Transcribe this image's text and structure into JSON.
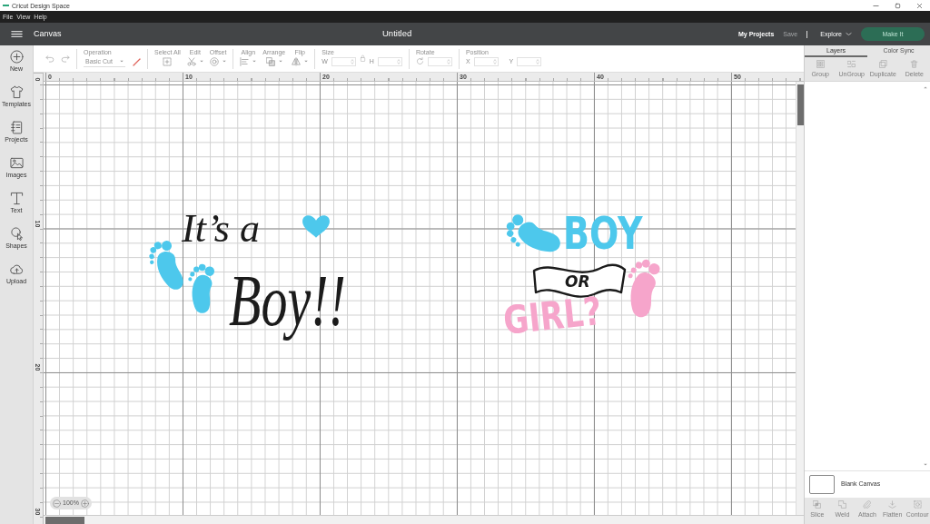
{
  "window": {
    "title": "Cricut Design Space"
  },
  "menu": [
    {
      "label": "File"
    },
    {
      "label": "View"
    },
    {
      "label": "Help"
    }
  ],
  "header": {
    "section": "Canvas",
    "document_title": "Untitled",
    "links": [
      {
        "label": "My Projects",
        "disabled": false
      },
      {
        "label": "Save",
        "disabled": true
      }
    ],
    "explore": {
      "label": "Explore"
    },
    "make_it": {
      "label": "Make It",
      "disabled": true
    }
  },
  "sidebar": {
    "items": [
      {
        "label": "New"
      },
      {
        "label": "Templates"
      },
      {
        "label": "Projects"
      },
      {
        "label": "Images"
      },
      {
        "label": "Text"
      },
      {
        "label": "Shapes"
      },
      {
        "label": "Upload"
      }
    ]
  },
  "toolbar": {
    "groups": [
      {
        "items": [
          {
            "kind": "undo",
            "disabled": true
          },
          {
            "kind": "redo",
            "disabled": true
          }
        ]
      },
      {
        "items": [
          {
            "kind": "dropdown",
            "label": "Operation",
            "value": "Basic Cut",
            "disabled": true
          }
        ]
      },
      {
        "items": [
          {
            "kind": "select_all",
            "label": "Select All",
            "menu": false,
            "disabled": true
          },
          {
            "kind": "edit",
            "label": "Edit",
            "menu": true,
            "disabled": true
          },
          {
            "kind": "offset",
            "label": "Offset",
            "menu": true,
            "disabled": true
          }
        ]
      },
      {
        "items": [
          {
            "kind": "align",
            "label": "Align",
            "menu": true,
            "disabled": true
          },
          {
            "kind": "arrange",
            "label": "Arrange",
            "menu": true,
            "disabled": true
          },
          {
            "kind": "flip",
            "label": "Flip",
            "menu": true,
            "disabled": true
          }
        ]
      },
      {
        "items": [
          {
            "kind": "size",
            "label": "Size",
            "fields": [
              {
                "label": "W"
              },
              {
                "label": "H"
              }
            ],
            "disabled": true
          }
        ]
      },
      {
        "items": [
          {
            "kind": "rotate",
            "label": "Rotate",
            "disabled": true
          }
        ]
      },
      {
        "items": [
          {
            "kind": "position",
            "label": "Position",
            "fields": [
              {
                "label": "X"
              },
              {
                "label": "Y"
              }
            ],
            "disabled": true
          }
        ]
      }
    ]
  },
  "rulers": {
    "horizontal": [
      "0",
      "10",
      "20",
      "30",
      "40",
      "50"
    ],
    "vertical": [
      "0",
      "10",
      "20",
      "30"
    ]
  },
  "canvas": {
    "designs": [
      {
        "kind": "its_a_boy",
        "texts": [
          {
            "text": "It’s a",
            "color": "#1b1b1b"
          },
          {
            "text": "Boy!!",
            "color": "#1b1b1b"
          }
        ],
        "footprints": [
          {
            "color": "#4dc8ec"
          },
          {
            "color": "#4dc8ec"
          }
        ],
        "heart": {
          "color": "#4dc8ec"
        }
      },
      {
        "kind": "boy_or_girl",
        "texts": [
          {
            "text": "BOY",
            "color": "#4dc8ec"
          },
          {
            "text": "OR",
            "color": "#1b1b1b"
          },
          {
            "text": "GIRL?",
            "color": "#f6a5cb"
          }
        ],
        "footprints": [
          {
            "color": "#4dc8ec"
          },
          {
            "color": "#f6a5cb"
          }
        ]
      }
    ],
    "zoom": {
      "value": "100%"
    }
  },
  "layers_panel": {
    "tabs": [
      {
        "label": "Layers",
        "selected": true
      },
      {
        "label": "Color Sync",
        "selected": false
      }
    ],
    "actions": [
      {
        "kind": "group",
        "label": "Group",
        "disabled": true
      },
      {
        "kind": "ungroup",
        "label": "UnGroup",
        "disabled": true
      },
      {
        "kind": "duplicate",
        "label": "Duplicate",
        "disabled": true
      },
      {
        "kind": "delete",
        "label": "Delete",
        "disabled": true
      }
    ],
    "layers": [
      {
        "name": "Blank Canvas"
      }
    ],
    "bottom_actions": [
      {
        "kind": "slice",
        "label": "Slice",
        "disabled": true
      },
      {
        "kind": "weld",
        "label": "Weld",
        "disabled": true
      },
      {
        "kind": "attach",
        "label": "Attach",
        "disabled": true
      },
      {
        "kind": "flatten",
        "label": "Flatten",
        "disabled": true
      },
      {
        "kind": "contour",
        "label": "Contour",
        "disabled": true
      }
    ]
  }
}
